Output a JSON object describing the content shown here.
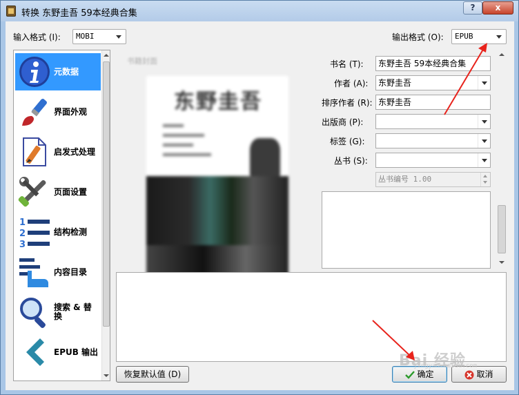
{
  "window": {
    "title": "转换 东野圭吾 59本经典合集",
    "help_button": "?",
    "close_button": "x"
  },
  "formats": {
    "input_label": "输入格式 (I):",
    "input_value": "MOBI",
    "output_label": "输出格式 (O):",
    "output_value": "EPUB"
  },
  "sidebar": {
    "items": [
      {
        "label": "元数据",
        "icon": "info-icon",
        "selected": true
      },
      {
        "label": "界面外观",
        "icon": "paintbrush-icon",
        "selected": false
      },
      {
        "label": "启发式处理",
        "icon": "document-pen-icon",
        "selected": false
      },
      {
        "label": "页面设置",
        "icon": "wrench-screwdriver-icon",
        "selected": false
      },
      {
        "label": "结构检测",
        "icon": "numbered-list-icon",
        "selected": false
      },
      {
        "label": "内容目录",
        "icon": "toc-hand-icon",
        "selected": false
      },
      {
        "label": "搜索 & 替换",
        "icon": "magnifier-icon",
        "selected": false
      },
      {
        "label": "EPUB 输出",
        "icon": "chevron-left-icon",
        "selected": false
      }
    ]
  },
  "cover": {
    "label": "书籍封面",
    "title": "东野圭吾"
  },
  "metadata": {
    "title_label": "书名 (T):",
    "title_value": "东野圭吾 59本经典合集",
    "author_label": "作者 (A):",
    "author_value": "东野圭吾",
    "author_sort_label": "排序作者 (R):",
    "author_sort_value": "东野圭吾",
    "publisher_label": "出版商 (P):",
    "publisher_value": "",
    "tags_label": "标签 (G):",
    "tags_value": "",
    "series_label": "丛书 (S):",
    "series_value": "",
    "series_index": "丛书编号 1.00"
  },
  "buttons": {
    "restore_defaults": "恢复默认值 (D)",
    "ok": "确定",
    "cancel": "取消"
  },
  "watermark": {
    "text": "Bai 经验",
    "sub": "jingyan.baidu.com"
  },
  "colors": {
    "selection": "#3399ff",
    "annotation": "#e8231c"
  }
}
